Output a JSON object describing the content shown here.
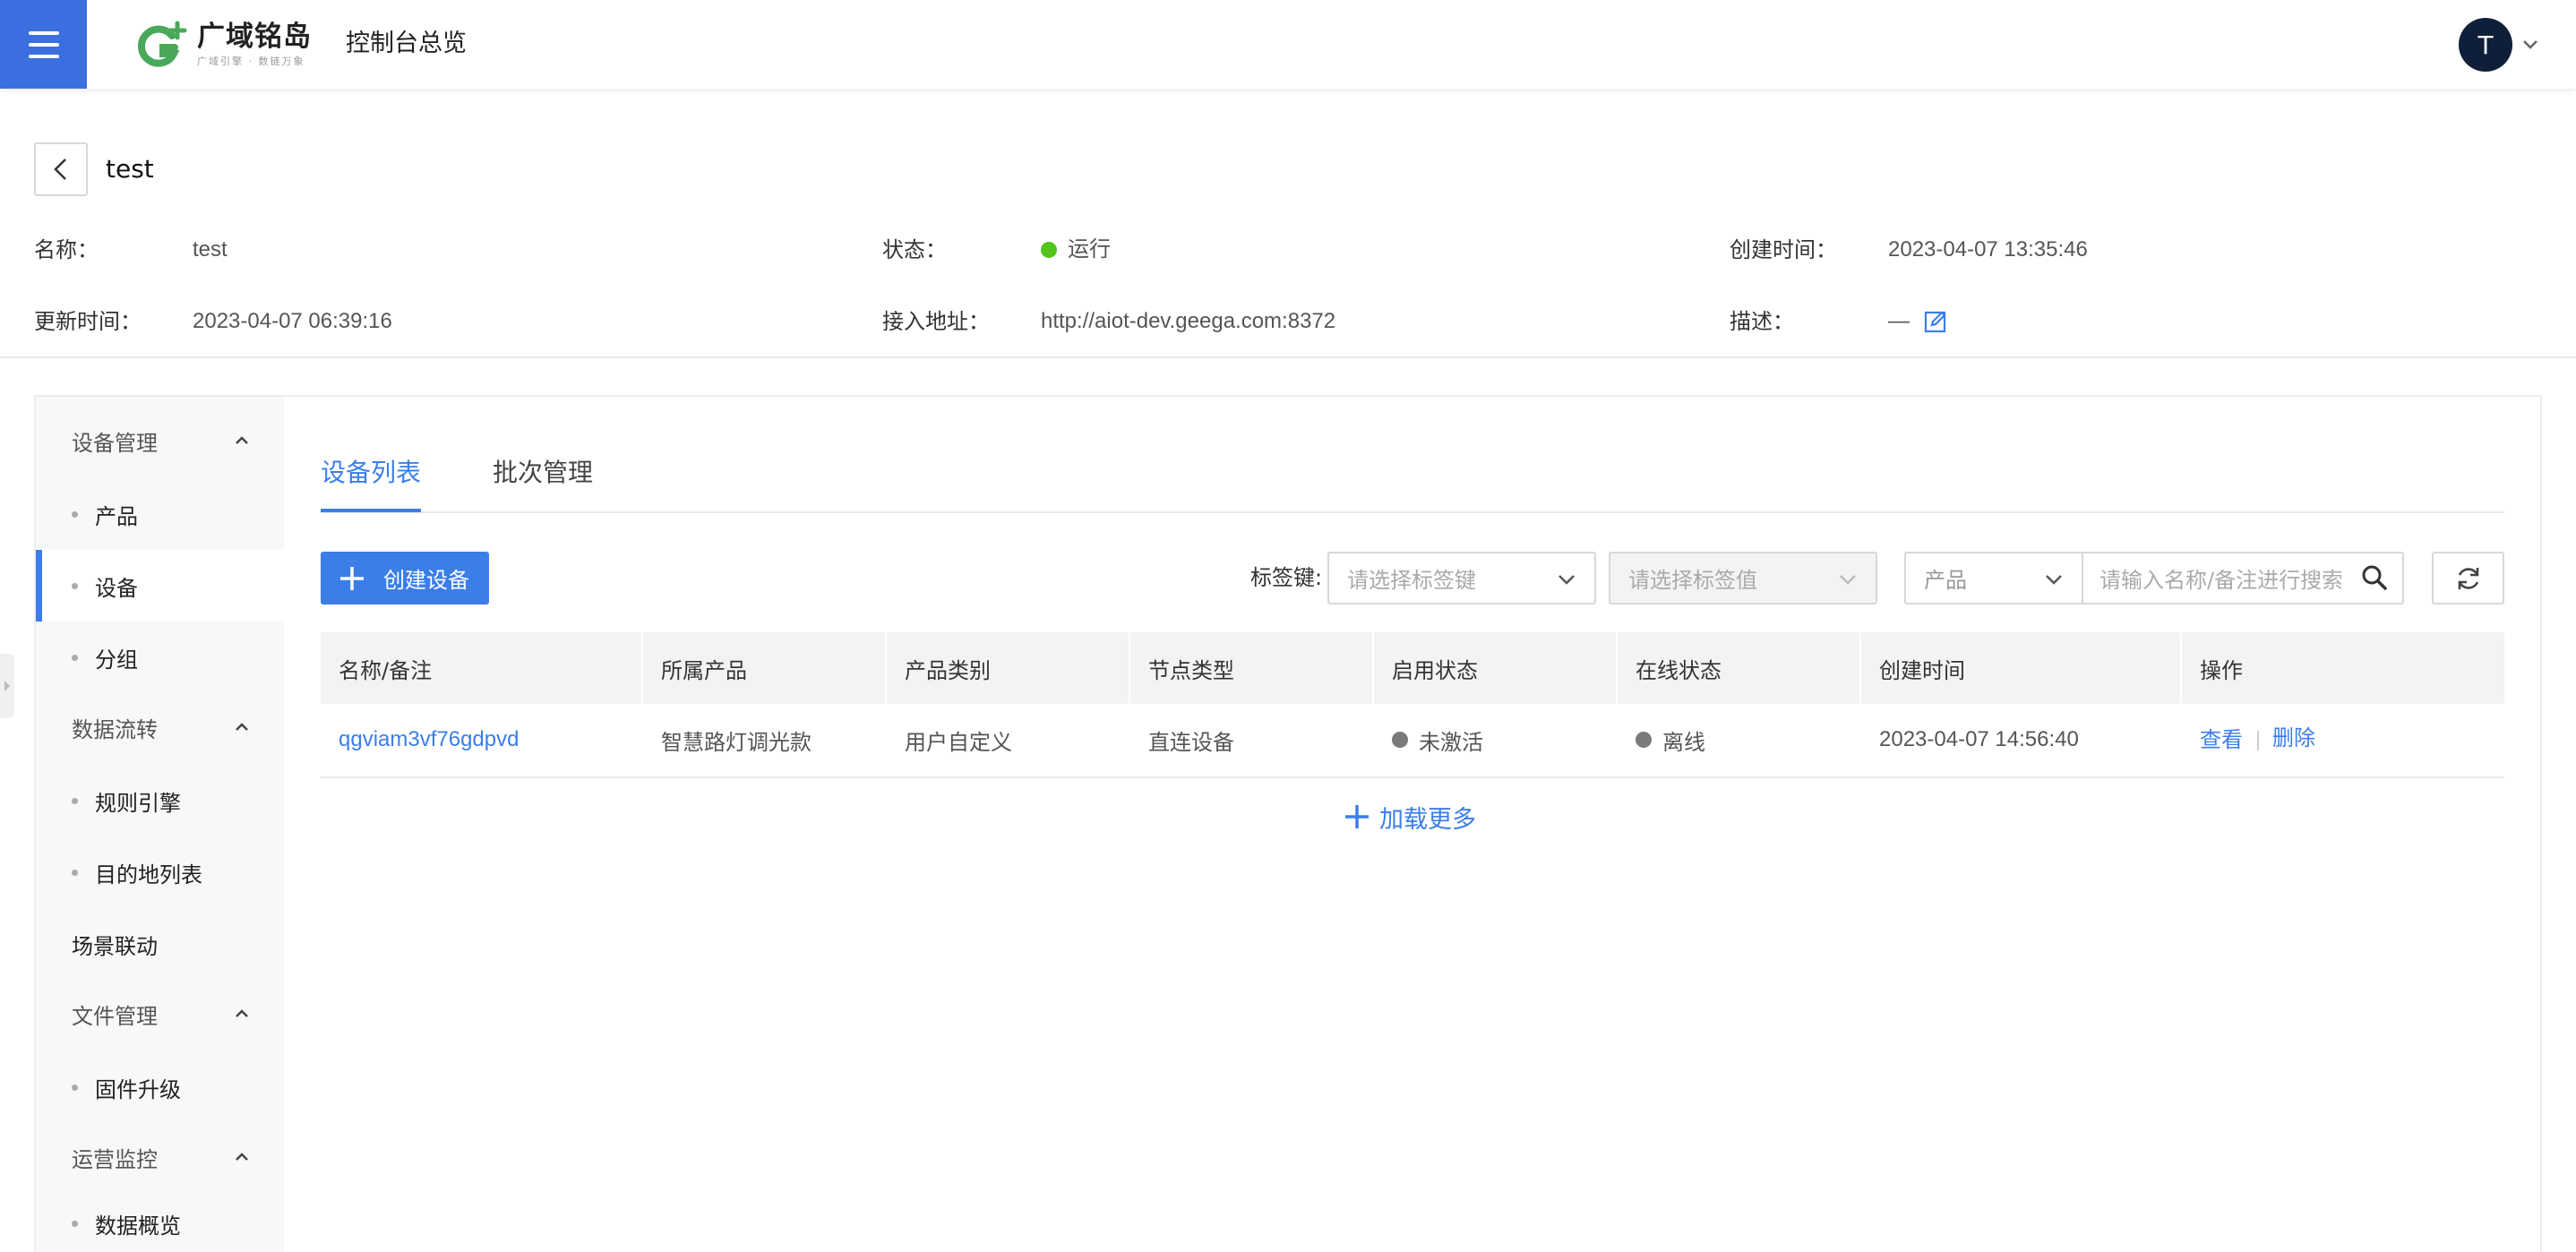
{
  "header": {
    "brand_name": "广域铭岛",
    "brand_sub": "广域引擎 · 数链万象",
    "console_title": "控制台总览",
    "avatar_initial": "T"
  },
  "page": {
    "title": "test",
    "info": {
      "name_label": "名称：",
      "name_value": "test",
      "status_label": "状态：",
      "status_value": "运行",
      "created_label": "创建时间：",
      "created_value": "2023-04-07 13:35:46",
      "updated_label": "更新时间：",
      "updated_value": "2023-04-07 06:39:16",
      "endpoint_label": "接入地址：",
      "endpoint_value": "http://aiot-dev.geega.com:8372",
      "desc_label": "描述：",
      "desc_value": "—"
    }
  },
  "sidebar": {
    "group_device": "设备管理",
    "item_product": "产品",
    "item_device": "设备",
    "item_group": "分组",
    "group_dataflow": "数据流转",
    "item_rules": "规则引擎",
    "item_destinations": "目的地列表",
    "plain_scene": "场景联动",
    "group_files": "文件管理",
    "item_firmware": "固件升级",
    "group_ops": "运营监控",
    "item_overview": "数据概览"
  },
  "tabs": {
    "device_list": "设备列表",
    "batch_mgmt": "批次管理"
  },
  "toolbar": {
    "create_label": "创建设备",
    "tag_key_label": "标签键:",
    "tag_key_placeholder": "请选择标签键",
    "tag_value_placeholder": "请选择标签值",
    "product_select": "产品",
    "search_placeholder": "请输入名称/备注进行搜索"
  },
  "table": {
    "headers": [
      "名称/备注",
      "所属产品",
      "产品类别",
      "节点类型",
      "启用状态",
      "在线状态",
      "创建时间",
      "操作"
    ],
    "rows": [
      {
        "name": "qgviam3vf76gdpvd",
        "product": "智慧路灯调光款",
        "category": "用户自定义",
        "node_type": "直连设备",
        "enable_status": "未激活",
        "online_status": "离线",
        "created": "2023-04-07 14:56:40",
        "action_view": "查看",
        "action_delete": "删除"
      }
    ],
    "load_more": "加载更多"
  },
  "colors": {
    "accent": "#3b7ee8",
    "menu_bg": "#3b6fe0",
    "status_running": "#52c41a",
    "status_inactive": "#7a7a7a"
  }
}
